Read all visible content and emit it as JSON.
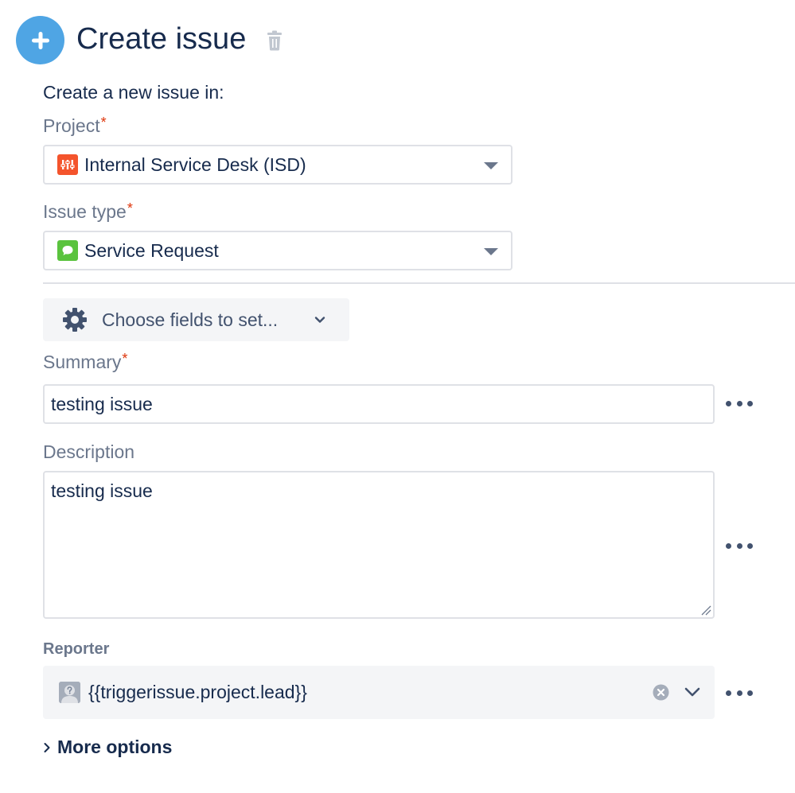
{
  "header": {
    "title": "Create issue",
    "icon": "plus-icon",
    "icon_color": "#4FA5E4"
  },
  "intro": "Create a new issue in:",
  "project": {
    "label": "Project",
    "required": "*",
    "value": "Internal Service Desk (ISD)",
    "icon": "project-icon",
    "icon_color": "#F4542C"
  },
  "issue_type": {
    "label": "Issue type",
    "required": "*",
    "value": "Service Request",
    "icon": "service-request-icon",
    "icon_color": "#5AC33E"
  },
  "choose_fields": {
    "label": "Choose fields to set..."
  },
  "summary": {
    "label": "Summary",
    "required": "*",
    "value": "testing issue"
  },
  "description": {
    "label": "Description",
    "value": "testing issue"
  },
  "reporter": {
    "label": "Reporter",
    "value": "{{triggerissue.project.lead}}"
  },
  "more_options": {
    "label": "More options"
  },
  "colors": {
    "text": "#172B4D",
    "label": "#6B778C",
    "required": "#DE350B",
    "border": "#DFE1E6",
    "subtle_bg": "#F4F5F7"
  }
}
